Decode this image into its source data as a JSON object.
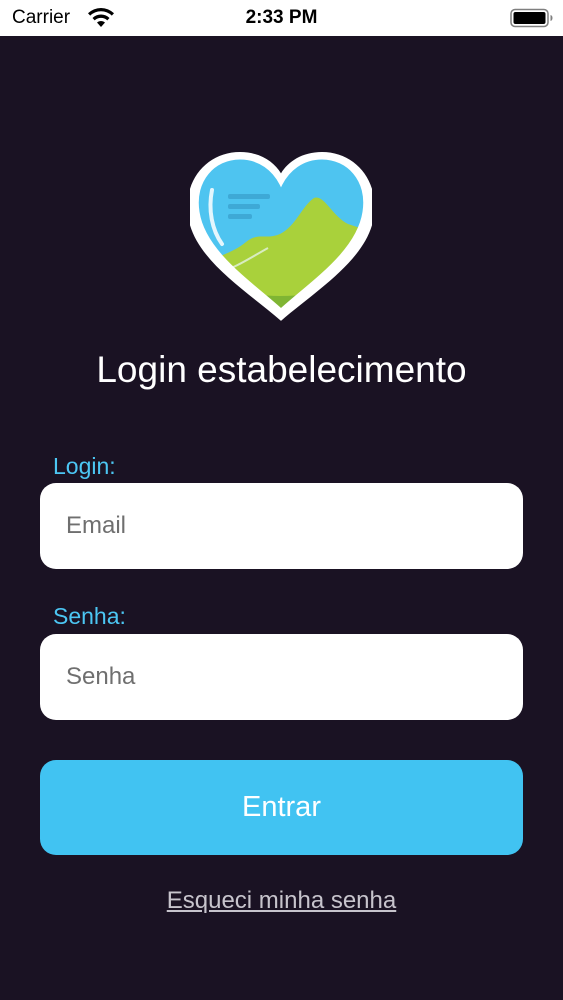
{
  "status_bar": {
    "carrier": "Carrier",
    "time": "2:33 PM",
    "icons": [
      "wifi-icon",
      "battery-icon"
    ]
  },
  "logo": {
    "icon": "heart-chart-logo",
    "colors": {
      "outline": "#ffffff",
      "sky": "#4ec4f0",
      "hill": "#a9d13b",
      "hill_dark": "#7fb533"
    }
  },
  "title": "Login estabelecimento",
  "form": {
    "login_label": "Login:",
    "email_placeholder": "Email",
    "password_label": "Senha:",
    "password_placeholder": "Senha",
    "submit_label": "Entrar",
    "forgot_label": "Esqueci minha senha"
  },
  "colors": {
    "background": "#1a1223",
    "accent": "#41c3f2",
    "label": "#4cc6f3",
    "link": "#c7c4cc"
  }
}
